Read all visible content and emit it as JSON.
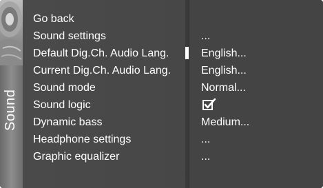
{
  "side_tab": {
    "title": "Sound",
    "picture_icon": "speaker-picture-icon"
  },
  "menu": {
    "items": [
      {
        "label": "Go back",
        "value": ""
      },
      {
        "label": "Sound settings",
        "value": "..."
      },
      {
        "label": "Default Dig.Ch. Audio Lang.",
        "value": "English..."
      },
      {
        "label": "Current Dig.Ch. Audio Lang.",
        "value": "English..."
      },
      {
        "label": "Sound mode",
        "value": "Normal..."
      },
      {
        "label": "Sound logic",
        "value": "",
        "checked": true,
        "icon": "checkbox-checked-icon"
      },
      {
        "label": "Dynamic bass",
        "value": "Medium..."
      },
      {
        "label": "Headphone settings",
        "value": "..."
      },
      {
        "label": "Graphic equalizer",
        "value": "..."
      }
    ],
    "selected_index": 2
  },
  "colors": {
    "panel_background": "#454545",
    "text": "#ffffff",
    "divider": "#383838",
    "selection_marker": "#ffffff"
  }
}
